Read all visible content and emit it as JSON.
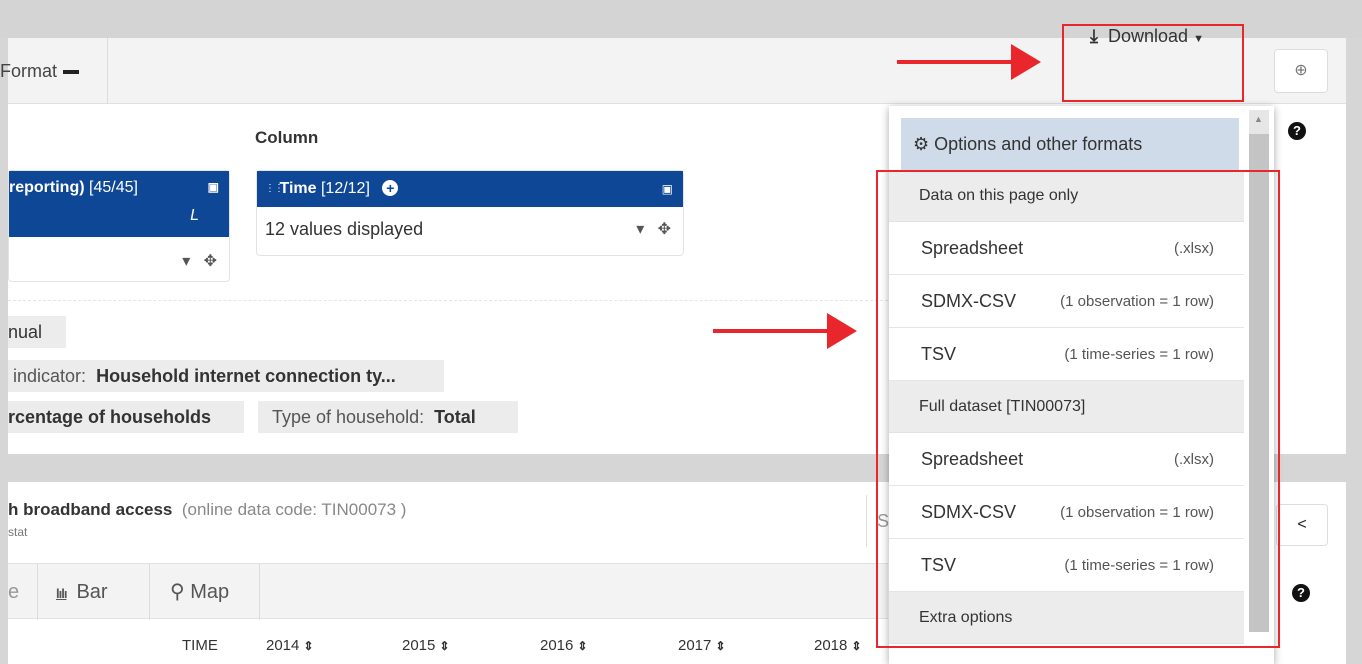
{
  "toolbar": {
    "format_label": "Format",
    "download_label": "Download",
    "plus_icon": "plus-circle-icon"
  },
  "layout_panel": {
    "column_label": "Column",
    "row_dimension": {
      "name": "reporting)",
      "count": "[45/45]",
      "letter": "L"
    },
    "time_dimension": {
      "name": "Time",
      "count": "[12/12]",
      "values_displayed": "12 values displayed"
    }
  },
  "filters": {
    "annual": "nual",
    "indicator_key": "indicator:",
    "indicator_value": "Household internet connection ty...",
    "unit_value": "rcentage of households",
    "household_key": "Type of household:",
    "household_value": "Total"
  },
  "dataset": {
    "title": "h broadband access",
    "code": "(online data code: TIN00073 )",
    "source": "stat",
    "search_stub": "S"
  },
  "view_tabs": {
    "table": "e",
    "bar": "Bar",
    "map": "Map"
  },
  "table": {
    "time_label": "TIME",
    "years": [
      "2014",
      "2015",
      "2016",
      "2017",
      "2018"
    ]
  },
  "dropdown": {
    "options_label": "Options and other formats",
    "section_page": "Data on this page only",
    "section_full": "Full dataset [TIN00073]",
    "section_extra": "Extra options",
    "page_items": [
      {
        "label": "Spreadsheet",
        "sub": "(.xlsx)"
      },
      {
        "label": "SDMX-CSV",
        "sub": "(1 observation = 1 row)"
      },
      {
        "label": "TSV",
        "sub": "(1 time-series = 1 row)"
      }
    ],
    "full_items": [
      {
        "label": "Spreadsheet",
        "sub": "(.xlsx)"
      },
      {
        "label": "SDMX-CSV",
        "sub": "(1 observation = 1 row)"
      },
      {
        "label": "TSV",
        "sub": "(1 time-series = 1 row)"
      }
    ]
  },
  "colors": {
    "dimension_header": "#0e4796",
    "annotation_red": "#e8262b",
    "options_highlight": "#cfdbe9"
  }
}
